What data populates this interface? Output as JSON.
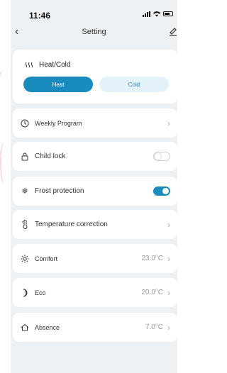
{
  "status_bar": {
    "time": "11:46"
  },
  "nav": {
    "title": "Setting",
    "back_icon": "chevron-left-icon",
    "edit_icon": "edit-icon"
  },
  "mode": {
    "label": "Heat/Cold",
    "heat_label": "Heat",
    "cold_label": "Cold",
    "selected": "Heat",
    "accent_color": "#1a8bbf"
  },
  "rows": {
    "weekly_program": "Weekly Program",
    "child_lock": "Child lock",
    "child_lock_on": false,
    "frost_protection": "Frost protection",
    "frost_protection_on": true,
    "temperature_correction": "Temperature correction",
    "comfort": "Comfort",
    "comfort_value": "23.0°C",
    "eco": "Eco",
    "eco_value": "20.0°C",
    "absence": "Absence",
    "absence_value": "7.0°C"
  }
}
